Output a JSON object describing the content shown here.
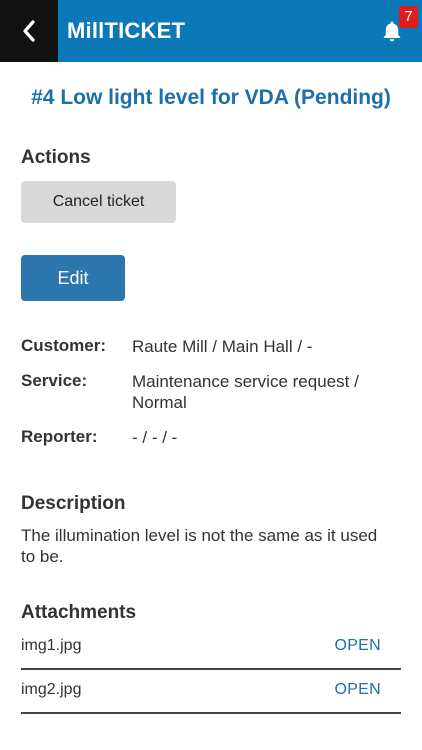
{
  "app": {
    "title": "MillTICKET",
    "notification_count": "7"
  },
  "ticket": {
    "title": "#4 Low light level for VDA (Pending)"
  },
  "actions": {
    "heading": "Actions",
    "cancel_label": "Cancel ticket",
    "edit_label": "Edit"
  },
  "details": {
    "customer_label": "Customer:",
    "customer_value": "Raute Mill / Main Hall / -",
    "service_label": "Service:",
    "service_value": "Maintenance service request / Normal",
    "reporter_label": "Reporter:",
    "reporter_value": "- / - / -"
  },
  "description": {
    "heading": "Description",
    "text": "The illumination level is not the same as it used to be."
  },
  "attachments": {
    "heading": "Attachments",
    "items": [
      {
        "name": "img1.jpg",
        "action": "OPEN"
      },
      {
        "name": "img2.jpg",
        "action": "OPEN"
      }
    ]
  },
  "colors": {
    "appbar": "#0b78b8",
    "accent": "#1c6fa8",
    "badge": "#e21b1b"
  },
  "icons": {
    "back": "chevron-left-icon",
    "notifications": "bell-icon"
  }
}
